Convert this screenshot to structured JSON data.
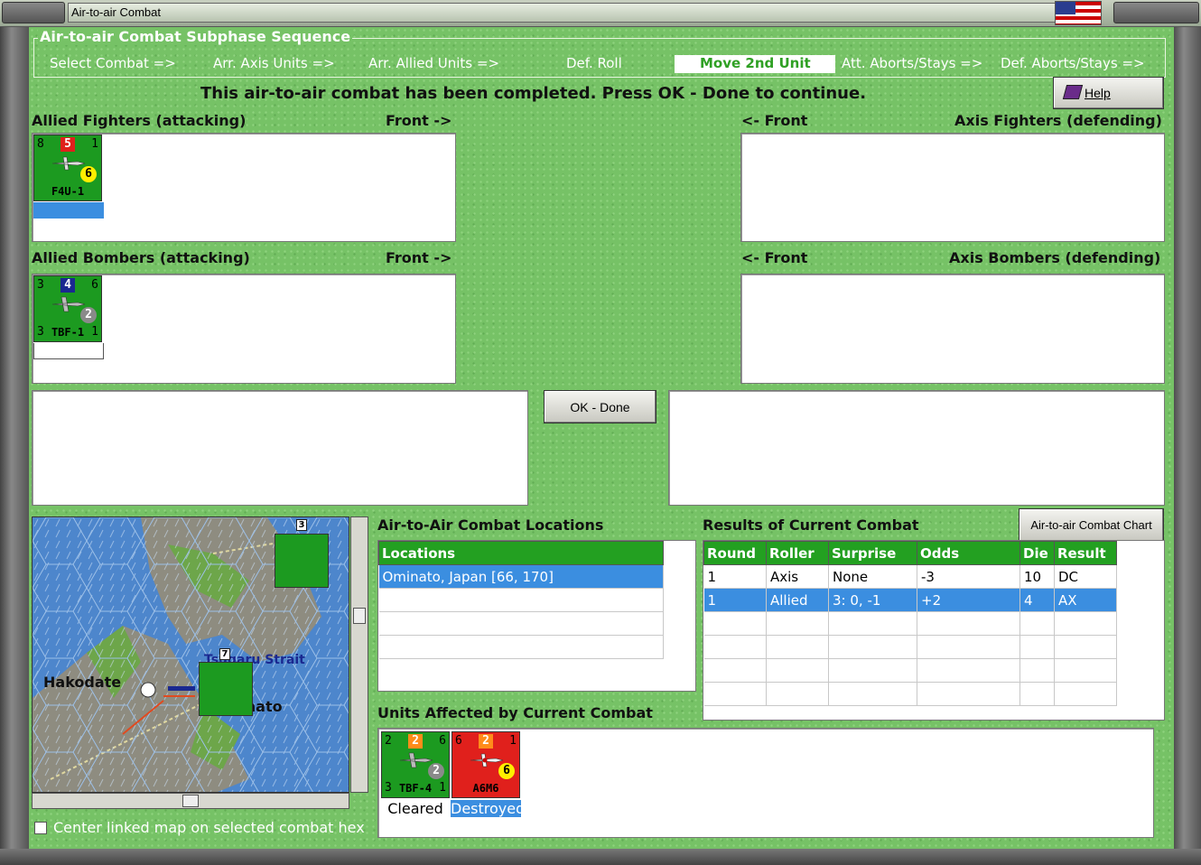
{
  "window": {
    "title": "Air-to-air Combat"
  },
  "sequence": {
    "title": "Air-to-air Combat Subphase Sequence",
    "steps": [
      "Select Combat =>",
      "Arr. Axis Units =>",
      "Arr. Allied Units =>",
      "Def. Roll",
      "Move 2nd Unit",
      "Att. Aborts/Stays =>",
      "Def. Aborts/Stays =>"
    ],
    "active_index": 4
  },
  "message": "This air-to-air combat has been completed.  Press OK - Done to continue.",
  "buttons": {
    "help": "Help",
    "ok_done": "OK - Done",
    "chart": "Air-to-air Combat Chart"
  },
  "sections": {
    "allied_fighters": "Allied Fighters (attacking)",
    "allied_bombers": "Allied Bombers (attacking)",
    "axis_fighters": "Axis Fighters (defending)",
    "axis_bombers": "Axis Bombers (defending)",
    "front_right": "Front ->",
    "front_left": "<- Front"
  },
  "units": {
    "allied_fighter": {
      "tl": "8",
      "tc": "5",
      "tr": "1",
      "circle": "6",
      "name": "F4U-1"
    },
    "allied_bomber": {
      "tl": "3",
      "tc": "4",
      "tr": "6",
      "circle": "2",
      "bl": "3",
      "name": "TBF-1",
      "br": "1"
    }
  },
  "map": {
    "labels": [
      "Hakodate",
      "Tsugaru Strait",
      "Ominato"
    ],
    "stack_numbers": [
      "3",
      "7"
    ]
  },
  "locations": {
    "heading": "Air-to-Air Combat Locations",
    "column": "Locations",
    "rows": [
      "Ominato, Japan [66, 170]"
    ]
  },
  "results": {
    "heading": "Results of Current Combat",
    "columns": [
      "Round",
      "Roller",
      "Surprise",
      "Odds",
      "Die",
      "Result"
    ],
    "rows": [
      [
        "1",
        "Axis",
        "None",
        "-3",
        "10",
        "DC"
      ],
      [
        "1",
        "Allied",
        "3: 0, -1",
        "+2",
        "4",
        "AX"
      ]
    ]
  },
  "affected": {
    "heading": "Units Affected by Current Combat",
    "units": [
      {
        "tl": "2",
        "tc": "2",
        "tr": "6",
        "circle": "2",
        "bl": "3",
        "name": "TBF-4",
        "br": "1",
        "status": "Cleared"
      },
      {
        "tl": "6",
        "tc": "2",
        "tr": "1",
        "circle": "6",
        "name": "A6M6",
        "status": "Destroyed"
      }
    ]
  },
  "checkbox": {
    "label": "Center linked map on selected combat hex",
    "checked": false
  },
  "colors": {
    "panel": "#76c266",
    "header": "#23a021",
    "selection": "#3b8ee0"
  }
}
